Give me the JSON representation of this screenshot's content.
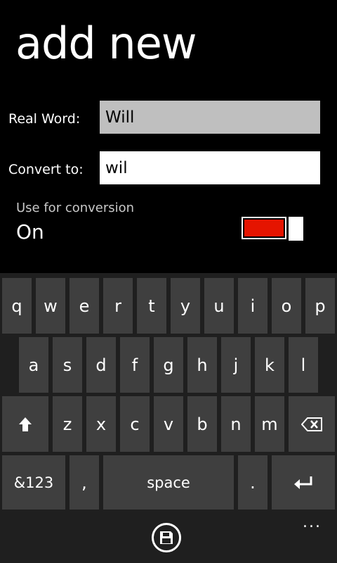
{
  "page": {
    "title": "add new"
  },
  "form": {
    "real_word_label": "Real Word:",
    "real_word_value": "Will",
    "convert_label": "Convert to:",
    "convert_value": "wil"
  },
  "toggle": {
    "label": "Use for conversion",
    "state": "On",
    "on_color": "#e51400"
  },
  "keyboard": {
    "row1": [
      "q",
      "w",
      "e",
      "r",
      "t",
      "y",
      "u",
      "i",
      "o",
      "p"
    ],
    "row2": [
      "a",
      "s",
      "d",
      "f",
      "g",
      "h",
      "j",
      "k",
      "l"
    ],
    "row3": [
      "z",
      "x",
      "c",
      "v",
      "b",
      "n",
      "m"
    ],
    "symbols_label": "&123",
    "comma_label": ",",
    "space_label": "space",
    "period_label": "."
  },
  "appbar": {
    "save_icon": "save-icon",
    "more_label": "..."
  }
}
